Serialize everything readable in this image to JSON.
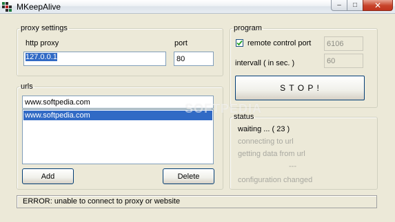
{
  "window": {
    "title": "MKeepAlive",
    "controls": {
      "minimize": "–",
      "maximize": "□",
      "close": "✕"
    }
  },
  "proxy": {
    "legend": "proxy settings",
    "http_label": "http proxy",
    "http_value": "127.0.0.1",
    "port_label": "port",
    "port_value": "80"
  },
  "urls": {
    "legend": "urls",
    "input_value": "www.softpedia.com",
    "items": [
      "www.softpedia.com"
    ],
    "add_label": "Add",
    "delete_label": "Delete"
  },
  "program": {
    "legend": "program",
    "remote_label": "remote control port",
    "remote_checked": true,
    "remote_port": "6106",
    "interval_label": "intervall ( in sec. )",
    "interval_value": "60",
    "stop_label": "S T O P !"
  },
  "status": {
    "legend": "status",
    "waiting": "waiting ... ( 23 )",
    "connecting": "connecting to url",
    "getting": "getting data from url",
    "dots": "---",
    "config": "configuration changed"
  },
  "statusbar": {
    "message": "ERROR: unable to connect to proxy or website"
  },
  "watermark": "SOFTPEDIA",
  "icons": {
    "app": "app-grid-icon",
    "check": "checkmark-icon"
  },
  "colors": {
    "selection": "#316ac5",
    "close_button": "#c7432a",
    "window_bg": "#ece9d8"
  }
}
